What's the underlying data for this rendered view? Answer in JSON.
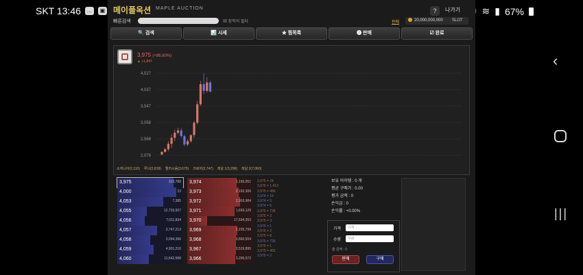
{
  "status_bar": {
    "carrier_time": "SKT 13:46",
    "battery": "67%"
  },
  "app": {
    "title": "메이플옥션",
    "subtitle": "MAPLE AUCTION",
    "help": "?",
    "exit": "나가기"
  },
  "search": {
    "quick_label": "빠른검색",
    "bookmark_label": "▦ 장착의 필터",
    "sell_link": "판매",
    "meso": "20,000,000,000",
    "slot": "SLOT"
  },
  "tabs": [
    {
      "icon": "search-icon",
      "label": "🔍 검색"
    },
    {
      "icon": "chart-icon",
      "label": "📊 시세"
    },
    {
      "icon": "star-icon",
      "label": "★ 찜목록"
    },
    {
      "icon": "info-icon",
      "label": "❶ 판매"
    },
    {
      "icon": "check-icon",
      "label": "☑ 완료"
    }
  ],
  "item": {
    "price_text": "3,975",
    "change_pct": "(+86.80%)",
    "change_abs": "▲ +1,847"
  },
  "chart_data": {
    "type": "candlestick",
    "yticks": [
      "4,527",
      "4,037",
      "3,547",
      "3,058",
      "2,568",
      "2,078"
    ],
    "ylim": [
      2078,
      4527
    ],
    "grid": true,
    "candles": [
      {
        "o": 2100,
        "h": 2200,
        "l": 2078,
        "c": 2180
      },
      {
        "o": 2180,
        "h": 2300,
        "l": 2150,
        "c": 2260
      },
      {
        "o": 2260,
        "h": 2500,
        "l": 2200,
        "c": 2420
      },
      {
        "o": 2420,
        "h": 2700,
        "l": 2300,
        "c": 2600
      },
      {
        "o": 2600,
        "h": 2850,
        "l": 2500,
        "c": 2750
      },
      {
        "o": 2750,
        "h": 2900,
        "l": 2700,
        "c": 2820
      },
      {
        "o": 2820,
        "h": 2900,
        "l": 2600,
        "c": 2650
      },
      {
        "o": 2650,
        "h": 2700,
        "l": 2350,
        "c": 2400
      },
      {
        "o": 2400,
        "h": 2550,
        "l": 2350,
        "c": 2500
      },
      {
        "o": 2500,
        "h": 2700,
        "l": 2450,
        "c": 2680
      },
      {
        "o": 2680,
        "h": 3100,
        "l": 2600,
        "c": 3050
      },
      {
        "o": 3050,
        "h": 3700,
        "l": 3000,
        "c": 3600
      },
      {
        "o": 3600,
        "h": 4300,
        "l": 3550,
        "c": 4200
      },
      {
        "o": 4200,
        "h": 4527,
        "l": 3900,
        "c": 4000
      },
      {
        "o": 4000,
        "h": 4400,
        "l": 3950,
        "c": 4250
      },
      {
        "o": 4250,
        "h": 4300,
        "l": 3950,
        "c": 3975
      }
    ],
    "legend": [
      "소저니아(2,110)",
      "루나(2,819)",
      "엘리시움(3,675)",
      "크로아(2,747)",
      "레날 1(3,296)",
      "레날 2(7,060)"
    ]
  },
  "buy_orders": [
    {
      "price": "3,975",
      "qty": "323,788",
      "fill": 0.85
    },
    {
      "price": "4,000",
      "qty": "13",
      "fill": 0.9
    },
    {
      "price": "4,053",
      "qty": "7,385",
      "fill": 0.7
    },
    {
      "price": "4,055",
      "qty": "12,703,927",
      "fill": 0.45
    },
    {
      "price": "4,056",
      "qty": "7,011,834",
      "fill": 0.42
    },
    {
      "price": "4,057",
      "qty": "3,747,213",
      "fill": 0.6
    },
    {
      "price": "4,058",
      "qty": "3,094,396",
      "fill": 0.5
    },
    {
      "price": "4,059",
      "qty": "4,901,216",
      "fill": 0.55
    },
    {
      "price": "4,060",
      "qty": "11,642,568",
      "fill": 0.48
    }
  ],
  "sell_orders": [
    {
      "price": "3,974",
      "qty": "1,156,051",
      "fill": 0.75
    },
    {
      "price": "3,973",
      "qty": "2,192,306",
      "fill": 0.78
    },
    {
      "price": "3,972",
      "qty": "2,903,984",
      "fill": 0.8
    },
    {
      "price": "3,971",
      "qty": "1,669,129",
      "fill": 0.72
    },
    {
      "price": "3,970",
      "qty": "17,594,353",
      "fill": 0.3
    },
    {
      "price": "3,969",
      "qty": "2,235,799",
      "fill": 0.76
    },
    {
      "price": "3,968",
      "qty": "3,660,504",
      "fill": 0.74
    },
    {
      "price": "3,967",
      "qty": "3,529,895",
      "fill": 0.74
    },
    {
      "price": "3,966",
      "qty": "3,295,572",
      "fill": 0.73
    }
  ],
  "trades": [
    {
      "text": "3,975 = 24",
      "dir": "up"
    },
    {
      "text": "3,975 = 1,413",
      "dir": "up"
    },
    {
      "text": "3,975 = 486",
      "dir": "up"
    },
    {
      "text": "3,974 = 19",
      "dir": "dn"
    },
    {
      "text": "3,974 = 5",
      "dir": "dn"
    },
    {
      "text": "3,974 = 5",
      "dir": "dn"
    },
    {
      "text": "3,975 = 728",
      "dir": "up"
    },
    {
      "text": "3,975 = 2",
      "dir": "up"
    },
    {
      "text": "3,975 = 3",
      "dir": "up"
    },
    {
      "text": "3,975 = 1",
      "dir": "dn"
    },
    {
      "text": "3,975 = 2",
      "dir": "up"
    },
    {
      "text": "3,975 = 8",
      "dir": "up"
    },
    {
      "text": "3,975 = 726",
      "dir": "dn"
    },
    {
      "text": "3,975 = 1",
      "dir": "up"
    },
    {
      "text": "3,975 = 455",
      "dir": "up"
    },
    {
      "text": "3,975 = 2",
      "dir": "dn"
    }
  ],
  "info": {
    "owned": "보유 아이템 : 0 개",
    "avg_price": "평균 구매가 : 0.00",
    "eval_amount": "평가 금액 : 0",
    "profit": "손익금 : 0",
    "profit_rate": "손익률 : +0.00%"
  },
  "order_form": {
    "price_label": "가격",
    "price_placeholder": "가격",
    "qty_label": "수량",
    "qty_placeholder": "수량",
    "total": "총 금액 : 0",
    "sell_button": "판매",
    "buy_button": "구매"
  },
  "colors": {
    "up": "#e46b5a",
    "down": "#6c6fb0",
    "gold": "#e7c568"
  }
}
